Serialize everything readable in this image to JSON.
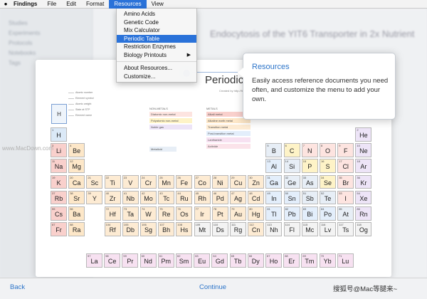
{
  "menubar": {
    "app_name": "Findings",
    "items": [
      "File",
      "Edit",
      "Format",
      "Resources",
      "View"
    ],
    "active_item": "Resources"
  },
  "resources_menu": {
    "items": [
      {
        "label": "Amino Acids"
      },
      {
        "label": "Genetic Code"
      },
      {
        "label": "Mix Calculator"
      },
      {
        "label": "Periodic Table",
        "highlighted": true
      },
      {
        "label": "Restriction Enzymes"
      },
      {
        "label": "Biology Printouts",
        "submenu": true
      }
    ],
    "bottom_items": [
      {
        "label": "About Resources..."
      },
      {
        "label": "Customize..."
      }
    ]
  },
  "callout": {
    "title": "Resources",
    "body": "Easily access reference documents you need often, and customize the menu to add your own."
  },
  "background": {
    "sidebar_items": [
      "Studies",
      "Experiments",
      "Protocols",
      "Notebooks",
      "Tags"
    ],
    "doc_title": "Endocytosis of the YIT6 Transporter in 2x Nutrient"
  },
  "periodic_table": {
    "title": "Periodic Table",
    "created": "Created by http://findingsapp.com",
    "key_symbol": "H",
    "key_labels": [
      "Atomic number",
      "Element symbol",
      "Atomic weight",
      "State at STP",
      "Element name"
    ],
    "category_groups": [
      "NON-METALS",
      "METALS"
    ],
    "nonmetal_categories": [
      {
        "label": "Diatomic non-metal",
        "color": "#fde4e0"
      },
      {
        "label": "Polyatomic non-metal",
        "color": "#fef3c7"
      },
      {
        "label": "Noble gas",
        "color": "#ede4f7"
      }
    ],
    "metal_categories": [
      {
        "label": "Alkali metal",
        "color": "#f9d0cc"
      },
      {
        "label": "Alkaline earth metal",
        "color": "#fde7c8"
      },
      {
        "label": "Transition metal",
        "color": "#fdebd3"
      },
      {
        "label": "Post-transition metal",
        "color": "#e3eefb"
      },
      {
        "label": "Lanthanide",
        "color": "#f7e1f1"
      },
      {
        "label": "Actinide",
        "color": "#fbe3ea"
      }
    ],
    "metalloid_label": "Metalloid",
    "elements": [
      {
        "n": 1,
        "s": "H",
        "r": 0,
        "c": 0,
        "color": "#dbe9f7"
      },
      {
        "n": 2,
        "s": "He",
        "r": 0,
        "c": 17,
        "color": "#ede4f7"
      },
      {
        "n": 3,
        "s": "Li",
        "r": 1,
        "c": 0,
        "color": "#f9d0cc"
      },
      {
        "n": 4,
        "s": "Be",
        "r": 1,
        "c": 1,
        "color": "#fde7c8"
      },
      {
        "n": 5,
        "s": "B",
        "r": 1,
        "c": 12,
        "color": "#e7eef6"
      },
      {
        "n": 6,
        "s": "C",
        "r": 1,
        "c": 13,
        "color": "#fef3c7"
      },
      {
        "n": 7,
        "s": "N",
        "r": 1,
        "c": 14,
        "color": "#fde4e0"
      },
      {
        "n": 8,
        "s": "O",
        "r": 1,
        "c": 15,
        "color": "#fde4e0"
      },
      {
        "n": 9,
        "s": "F",
        "r": 1,
        "c": 16,
        "color": "#fde4e0"
      },
      {
        "n": 10,
        "s": "Ne",
        "r": 1,
        "c": 17,
        "color": "#ede4f7"
      },
      {
        "n": 11,
        "s": "Na",
        "r": 2,
        "c": 0,
        "color": "#f9d0cc"
      },
      {
        "n": 12,
        "s": "Mg",
        "r": 2,
        "c": 1,
        "color": "#fde7c8"
      },
      {
        "n": 13,
        "s": "Al",
        "r": 2,
        "c": 12,
        "color": "#e3eefb"
      },
      {
        "n": 14,
        "s": "Si",
        "r": 2,
        "c": 13,
        "color": "#e7eef6"
      },
      {
        "n": 15,
        "s": "P",
        "r": 2,
        "c": 14,
        "color": "#fef3c7"
      },
      {
        "n": 16,
        "s": "S",
        "r": 2,
        "c": 15,
        "color": "#fef3c7"
      },
      {
        "n": 17,
        "s": "Cl",
        "r": 2,
        "c": 16,
        "color": "#fde4e0"
      },
      {
        "n": 18,
        "s": "Ar",
        "r": 2,
        "c": 17,
        "color": "#ede4f7"
      },
      {
        "n": 19,
        "s": "K",
        "r": 3,
        "c": 0,
        "color": "#f9d0cc"
      },
      {
        "n": 20,
        "s": "Ca",
        "r": 3,
        "c": 1,
        "color": "#fde7c8"
      },
      {
        "n": 21,
        "s": "Sc",
        "r": 3,
        "c": 2,
        "color": "#fdebd3"
      },
      {
        "n": 22,
        "s": "Ti",
        "r": 3,
        "c": 3,
        "color": "#fdebd3"
      },
      {
        "n": 23,
        "s": "V",
        "r": 3,
        "c": 4,
        "color": "#fdebd3"
      },
      {
        "n": 24,
        "s": "Cr",
        "r": 3,
        "c": 5,
        "color": "#fdebd3"
      },
      {
        "n": 25,
        "s": "Mn",
        "r": 3,
        "c": 6,
        "color": "#fdebd3"
      },
      {
        "n": 26,
        "s": "Fe",
        "r": 3,
        "c": 7,
        "color": "#fdebd3"
      },
      {
        "n": 27,
        "s": "Co",
        "r": 3,
        "c": 8,
        "color": "#fdebd3"
      },
      {
        "n": 28,
        "s": "Ni",
        "r": 3,
        "c": 9,
        "color": "#fdebd3"
      },
      {
        "n": 29,
        "s": "Cu",
        "r": 3,
        "c": 10,
        "color": "#fdebd3"
      },
      {
        "n": 30,
        "s": "Zn",
        "r": 3,
        "c": 11,
        "color": "#fdebd3"
      },
      {
        "n": 31,
        "s": "Ga",
        "r": 3,
        "c": 12,
        "color": "#e3eefb"
      },
      {
        "n": 32,
        "s": "Ge",
        "r": 3,
        "c": 13,
        "color": "#e7eef6"
      },
      {
        "n": 33,
        "s": "As",
        "r": 3,
        "c": 14,
        "color": "#e7eef6"
      },
      {
        "n": 34,
        "s": "Se",
        "r": 3,
        "c": 15,
        "color": "#fef3c7"
      },
      {
        "n": 35,
        "s": "Br",
        "r": 3,
        "c": 16,
        "color": "#fde4e0"
      },
      {
        "n": 36,
        "s": "Kr",
        "r": 3,
        "c": 17,
        "color": "#ede4f7"
      },
      {
        "n": 37,
        "s": "Rb",
        "r": 4,
        "c": 0,
        "color": "#f9d0cc"
      },
      {
        "n": 38,
        "s": "Sr",
        "r": 4,
        "c": 1,
        "color": "#fde7c8"
      },
      {
        "n": 39,
        "s": "Y",
        "r": 4,
        "c": 2,
        "color": "#fdebd3"
      },
      {
        "n": 40,
        "s": "Zr",
        "r": 4,
        "c": 3,
        "color": "#fdebd3"
      },
      {
        "n": 41,
        "s": "Nb",
        "r": 4,
        "c": 4,
        "color": "#fdebd3"
      },
      {
        "n": 42,
        "s": "Mo",
        "r": 4,
        "c": 5,
        "color": "#fdebd3"
      },
      {
        "n": 43,
        "s": "Tc",
        "r": 4,
        "c": 6,
        "color": "#fdebd3"
      },
      {
        "n": 44,
        "s": "Ru",
        "r": 4,
        "c": 7,
        "color": "#fdebd3"
      },
      {
        "n": 45,
        "s": "Rh",
        "r": 4,
        "c": 8,
        "color": "#fdebd3"
      },
      {
        "n": 46,
        "s": "Pd",
        "r": 4,
        "c": 9,
        "color": "#fdebd3"
      },
      {
        "n": 47,
        "s": "Ag",
        "r": 4,
        "c": 10,
        "color": "#fdebd3"
      },
      {
        "n": 48,
        "s": "Cd",
        "r": 4,
        "c": 11,
        "color": "#fdebd3"
      },
      {
        "n": 49,
        "s": "In",
        "r": 4,
        "c": 12,
        "color": "#e3eefb"
      },
      {
        "n": 50,
        "s": "Sn",
        "r": 4,
        "c": 13,
        "color": "#e3eefb"
      },
      {
        "n": 51,
        "s": "Sb",
        "r": 4,
        "c": 14,
        "color": "#e7eef6"
      },
      {
        "n": 52,
        "s": "Te",
        "r": 4,
        "c": 15,
        "color": "#e7eef6"
      },
      {
        "n": 53,
        "s": "I",
        "r": 4,
        "c": 16,
        "color": "#fde4e0"
      },
      {
        "n": 54,
        "s": "Xe",
        "r": 4,
        "c": 17,
        "color": "#ede4f7"
      },
      {
        "n": 55,
        "s": "Cs",
        "r": 5,
        "c": 0,
        "color": "#f9d0cc"
      },
      {
        "n": 56,
        "s": "Ba",
        "r": 5,
        "c": 1,
        "color": "#fde7c8"
      },
      {
        "n": 72,
        "s": "Hf",
        "r": 5,
        "c": 3,
        "color": "#fdebd3"
      },
      {
        "n": 73,
        "s": "Ta",
        "r": 5,
        "c": 4,
        "color": "#fdebd3"
      },
      {
        "n": 74,
        "s": "W",
        "r": 5,
        "c": 5,
        "color": "#fdebd3"
      },
      {
        "n": 75,
        "s": "Re",
        "r": 5,
        "c": 6,
        "color": "#fdebd3"
      },
      {
        "n": 76,
        "s": "Os",
        "r": 5,
        "c": 7,
        "color": "#fdebd3"
      },
      {
        "n": 77,
        "s": "Ir",
        "r": 5,
        "c": 8,
        "color": "#fdebd3"
      },
      {
        "n": 78,
        "s": "Pt",
        "r": 5,
        "c": 9,
        "color": "#fdebd3"
      },
      {
        "n": 79,
        "s": "Au",
        "r": 5,
        "c": 10,
        "color": "#fdebd3"
      },
      {
        "n": 80,
        "s": "Hg",
        "r": 5,
        "c": 11,
        "color": "#fdebd3"
      },
      {
        "n": 81,
        "s": "Tl",
        "r": 5,
        "c": 12,
        "color": "#e3eefb"
      },
      {
        "n": 82,
        "s": "Pb",
        "r": 5,
        "c": 13,
        "color": "#e3eefb"
      },
      {
        "n": 83,
        "s": "Bi",
        "r": 5,
        "c": 14,
        "color": "#e3eefb"
      },
      {
        "n": 84,
        "s": "Po",
        "r": 5,
        "c": 15,
        "color": "#e3eefb"
      },
      {
        "n": 85,
        "s": "At",
        "r": 5,
        "c": 16,
        "color": "#e7eef6"
      },
      {
        "n": 86,
        "s": "Rn",
        "r": 5,
        "c": 17,
        "color": "#ede4f7"
      },
      {
        "n": 87,
        "s": "Fr",
        "r": 6,
        "c": 0,
        "color": "#f9d0cc"
      },
      {
        "n": 88,
        "s": "Ra",
        "r": 6,
        "c": 1,
        "color": "#fde7c8"
      },
      {
        "n": 104,
        "s": "Rf",
        "r": 6,
        "c": 3,
        "color": "#fdebd3"
      },
      {
        "n": 105,
        "s": "Db",
        "r": 6,
        "c": 4,
        "color": "#fdebd3"
      },
      {
        "n": 106,
        "s": "Sg",
        "r": 6,
        "c": 5,
        "color": "#fdebd3"
      },
      {
        "n": 107,
        "s": "Bh",
        "r": 6,
        "c": 6,
        "color": "#fdebd3"
      },
      {
        "n": 108,
        "s": "Hs",
        "r": 6,
        "c": 7,
        "color": "#fdebd3"
      },
      {
        "n": 109,
        "s": "Mt",
        "r": 6,
        "c": 8,
        "color": "#f3f3f3"
      },
      {
        "n": 110,
        "s": "Ds",
        "r": 6,
        "c": 9,
        "color": "#f3f3f3"
      },
      {
        "n": 111,
        "s": "Rg",
        "r": 6,
        "c": 10,
        "color": "#f3f3f3"
      },
      {
        "n": 112,
        "s": "Cn",
        "r": 6,
        "c": 11,
        "color": "#fdebd3"
      },
      {
        "n": 113,
        "s": "Nh",
        "r": 6,
        "c": 12,
        "color": "#f3f3f3"
      },
      {
        "n": 114,
        "s": "Fl",
        "r": 6,
        "c": 13,
        "color": "#f3f3f3"
      },
      {
        "n": 115,
        "s": "Mc",
        "r": 6,
        "c": 14,
        "color": "#f3f3f3"
      },
      {
        "n": 116,
        "s": "Lv",
        "r": 6,
        "c": 15,
        "color": "#f3f3f3"
      },
      {
        "n": 117,
        "s": "Ts",
        "r": 6,
        "c": 16,
        "color": "#f3f3f3"
      },
      {
        "n": 118,
        "s": "Og",
        "r": 6,
        "c": 17,
        "color": "#f3f3f3"
      }
    ],
    "lanthanides": [
      {
        "n": 57,
        "s": "La"
      },
      {
        "n": 58,
        "s": "Ce"
      },
      {
        "n": 59,
        "s": "Pr"
      },
      {
        "n": 60,
        "s": "Nd"
      },
      {
        "n": 61,
        "s": "Pm"
      },
      {
        "n": 62,
        "s": "Sm"
      },
      {
        "n": 63,
        "s": "Eu"
      },
      {
        "n": 64,
        "s": "Gd"
      },
      {
        "n": 65,
        "s": "Tb"
      },
      {
        "n": 66,
        "s": "Dy"
      },
      {
        "n": 67,
        "s": "Ho"
      },
      {
        "n": 68,
        "s": "Er"
      },
      {
        "n": 69,
        "s": "Tm"
      },
      {
        "n": 70,
        "s": "Yb"
      },
      {
        "n": 71,
        "s": "Lu"
      }
    ],
    "lanthanide_color": "#f7e1f1"
  },
  "bottom_bar": {
    "back_label": "Back",
    "continue_label": "Continue"
  },
  "watermarks": {
    "right": "搜狐号@Mac等腿来~",
    "left": "www.MacDown.com"
  }
}
